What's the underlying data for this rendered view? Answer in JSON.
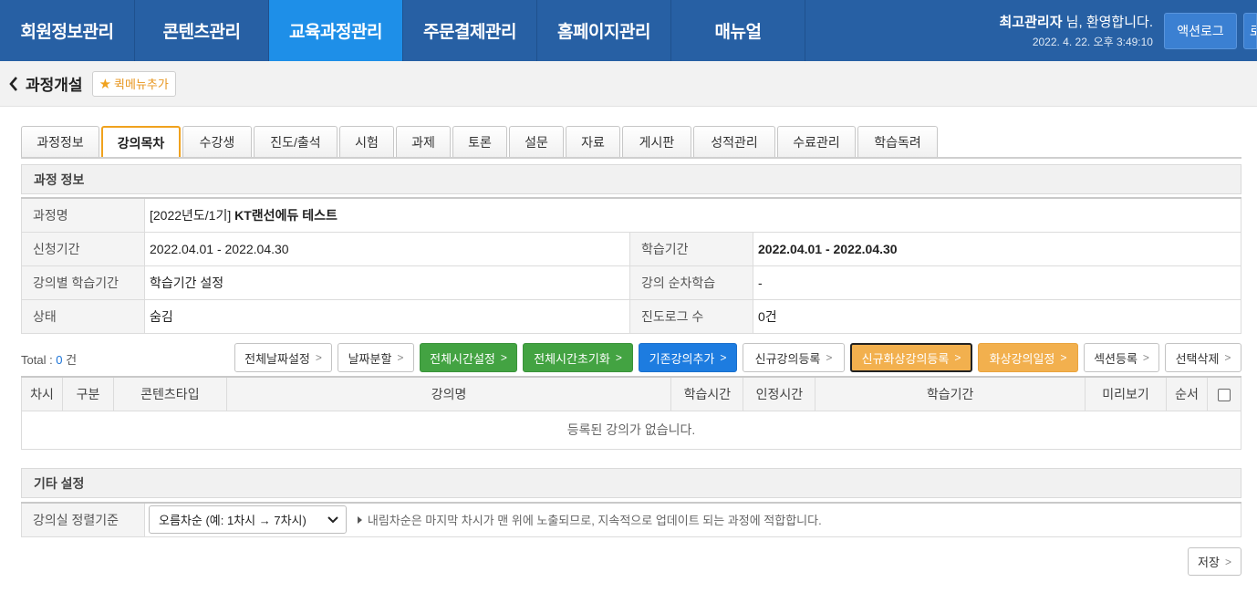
{
  "nav": {
    "items": [
      {
        "label": "회원정보관리"
      },
      {
        "label": "콘텐츠관리"
      },
      {
        "label": "교육과정관리"
      },
      {
        "label": "주문결제관리"
      },
      {
        "label": "홈페이지관리"
      },
      {
        "label": "매뉴얼"
      }
    ],
    "active_index": 2,
    "user_name": "최고관리자",
    "welcome_suffix": " 님, 환영합니다.",
    "datetime": "2022. 4. 22. 오후 3:49:10",
    "action_log_label": "액션로그",
    "extra_button_label": "로"
  },
  "page": {
    "title": "과정개설",
    "quick_menu_label": "퀵메뉴추가"
  },
  "tabs": [
    {
      "label": "과정정보"
    },
    {
      "label": "강의목차"
    },
    {
      "label": "수강생"
    },
    {
      "label": "진도/출석"
    },
    {
      "label": "시험"
    },
    {
      "label": "과제"
    },
    {
      "label": "토론"
    },
    {
      "label": "설문"
    },
    {
      "label": "자료"
    },
    {
      "label": "게시판"
    },
    {
      "label": "성적관리"
    },
    {
      "label": "수료관리"
    },
    {
      "label": "학습독려"
    }
  ],
  "active_tab_index": 1,
  "course_info": {
    "section_title": "과정 정보",
    "name_label": "과정명",
    "name_prefix": "[2022년도/1기]",
    "name_value": "KT랜선에듀 테스트",
    "apply_period_label": "신청기간",
    "apply_period_value": "2022.04.01 - 2022.04.30",
    "study_period_label": "학습기간",
    "study_period_value": "2022.04.01 - 2022.04.30",
    "lecture_period_label": "강의별 학습기간",
    "lecture_period_value": "학습기간 설정",
    "sequential_label": "강의 순차학습",
    "sequential_value": "-",
    "status_label": "상태",
    "status_value": "숨김",
    "progress_log_label": "진도로그 수",
    "progress_log_value": "0건"
  },
  "list": {
    "total_prefix": "Total : ",
    "total_count": "0",
    "total_suffix": " 건",
    "buttons": [
      {
        "label": "전체날짜설정",
        "style": "default"
      },
      {
        "label": "날짜분할",
        "style": "default"
      },
      {
        "label": "전체시간설정",
        "style": "green"
      },
      {
        "label": "전체시간초기화",
        "style": "green"
      },
      {
        "label": "기존강의추가",
        "style": "blue"
      },
      {
        "label": "신규강의등록",
        "style": "default"
      },
      {
        "label": "신규화상강의등록",
        "style": "orange-outline"
      },
      {
        "label": "화상강의일정",
        "style": "orange"
      },
      {
        "label": "섹션등록",
        "style": "default"
      },
      {
        "label": "선택삭제",
        "style": "default"
      }
    ],
    "columns": [
      "차시",
      "구분",
      "콘텐츠타입",
      "강의명",
      "학습시간",
      "인정시간",
      "학습기간",
      "미리보기",
      "순서"
    ],
    "empty_message": "등록된 강의가 없습니다."
  },
  "settings": {
    "section_title": "기타 설정",
    "sort_label": "강의실 정렬기준",
    "sort_selected": "오름차순 (예: 1차시 → 7차시)",
    "sort_hint": "내림차순은 마지막 차시가 맨 위에 노출되므로, 지속적으로 업데이트 되는 과정에 적합합니다."
  },
  "save_label": "저장",
  "colors": {
    "nav_bg": "#2760a4",
    "nav_active": "#1e8fe8",
    "accent_orange": "#f0a21e",
    "green": "#43a342",
    "blue": "#1d7ce0"
  }
}
